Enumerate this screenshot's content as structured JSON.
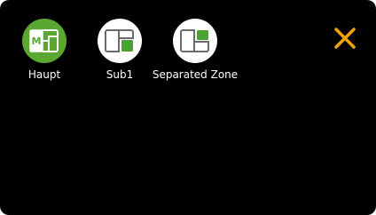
{
  "colors": {
    "background": "#000000",
    "active_zone": "#5aa832",
    "inactive_zone": "#ffffff",
    "icon_green": "#4aa232",
    "close_accent": "#f5a300"
  },
  "zones": [
    {
      "label": "Haupt",
      "badge": "M",
      "active": true,
      "icon": "main-zone-icon"
    },
    {
      "label": "Sub1",
      "active": false,
      "icon": "sub-zone-icon"
    },
    {
      "label": "Separated Zone",
      "active": false,
      "icon": "separated-zone-icon"
    }
  ],
  "close": {
    "icon": "close-icon"
  }
}
